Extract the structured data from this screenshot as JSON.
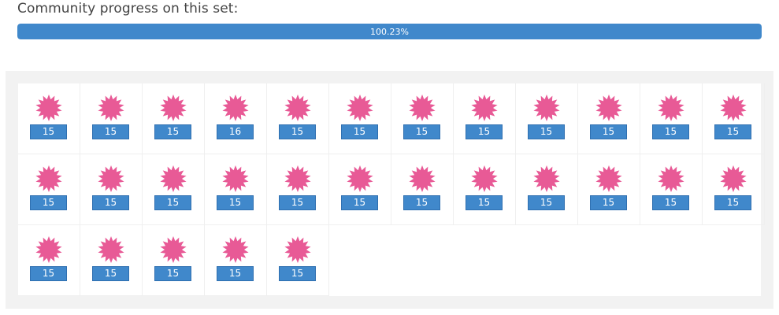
{
  "header": {
    "title": "Community progress on this set:"
  },
  "progress": {
    "percent_label": "100.23%",
    "fill_fraction": 1.0,
    "color": "#4088cb"
  },
  "collection": {
    "icon": "pink-starburst-icon",
    "icon_color": "#e85a96",
    "items": [
      {
        "count": "15"
      },
      {
        "count": "15"
      },
      {
        "count": "15"
      },
      {
        "count": "16"
      },
      {
        "count": "15"
      },
      {
        "count": "15"
      },
      {
        "count": "15"
      },
      {
        "count": "15"
      },
      {
        "count": "15"
      },
      {
        "count": "15"
      },
      {
        "count": "15"
      },
      {
        "count": "15"
      },
      {
        "count": "15"
      },
      {
        "count": "15"
      },
      {
        "count": "15"
      },
      {
        "count": "15"
      },
      {
        "count": "15"
      },
      {
        "count": "15"
      },
      {
        "count": "15"
      },
      {
        "count": "15"
      },
      {
        "count": "15"
      },
      {
        "count": "15"
      },
      {
        "count": "15"
      },
      {
        "count": "15"
      },
      {
        "count": "15"
      },
      {
        "count": "15"
      },
      {
        "count": "15"
      },
      {
        "count": "15"
      },
      {
        "count": "15"
      }
    ]
  }
}
